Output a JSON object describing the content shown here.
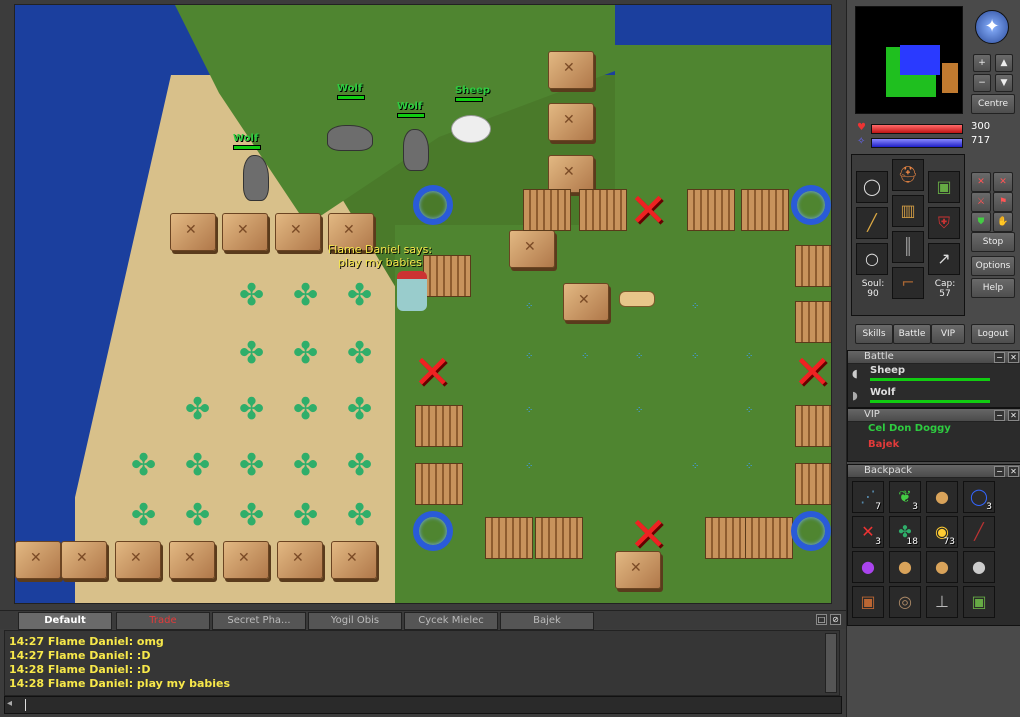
{
  "game": {
    "creatures": [
      {
        "name": "Wolf"
      },
      {
        "name": "Wolf"
      },
      {
        "name": "Wolf"
      },
      {
        "name": "Sheep"
      }
    ],
    "speech": {
      "speaker_line": "Flame Daniel says:",
      "message": "play my babies"
    }
  },
  "status": {
    "health": "300",
    "mana": "717"
  },
  "equipment": {
    "soul_label": "Soul:",
    "soul": "90",
    "cap_label": "Cap:",
    "cap": "57"
  },
  "buttons": {
    "centre": "Centre",
    "stop": "Stop",
    "options": "Options",
    "help": "Help",
    "skills": "Skills",
    "battle": "Battle",
    "vip": "VIP",
    "logout": "Logout"
  },
  "battle": {
    "title": "Battle",
    "entries": [
      "Sheep",
      "Wolf"
    ]
  },
  "vip": {
    "title": "VIP",
    "entries": [
      "Cel Don Doggy",
      "Bajek"
    ]
  },
  "backpack": {
    "title": "Backpack",
    "items": [
      {
        "icon": "arrows-icon",
        "count": "7"
      },
      {
        "icon": "herb-icon",
        "count": "3"
      },
      {
        "icon": "bag-icon",
        "count": ""
      },
      {
        "icon": "ring-icon",
        "count": "3"
      },
      {
        "icon": "x-rune-icon",
        "count": "3"
      },
      {
        "icon": "plant-icon",
        "count": "18"
      },
      {
        "icon": "gold-coins-icon",
        "count": "73"
      },
      {
        "icon": "rod-icon",
        "count": ""
      },
      {
        "icon": "purple-potion-icon",
        "count": ""
      },
      {
        "icon": "bag-icon",
        "count": ""
      },
      {
        "icon": "bag-icon",
        "count": ""
      },
      {
        "icon": "stone-icon",
        "count": ""
      },
      {
        "icon": "backpack-icon",
        "count": ""
      },
      {
        "icon": "rope-icon",
        "count": ""
      },
      {
        "icon": "shovel-icon",
        "count": ""
      },
      {
        "icon": "green-backpack-icon",
        "count": ""
      }
    ]
  },
  "chat": {
    "tabs": [
      "Default",
      "Trade",
      "Secret Pha...",
      "Yogil Obis",
      "Cycek Mielec",
      "Bajek"
    ],
    "active_tab": "Default",
    "lines": [
      "14:27 Flame Daniel: omg",
      "14:27 Flame Daniel: :D",
      "14:28 Flame Daniel: :D",
      "14:28 Flame Daniel: play my babies"
    ]
  },
  "colors": {
    "chat_text": "#f7e84a",
    "creature_name": "#2ecc40",
    "vip_online": "#2ecc40",
    "vip_offline": "#e23a3a",
    "trade_tab": "#e23a3a"
  }
}
